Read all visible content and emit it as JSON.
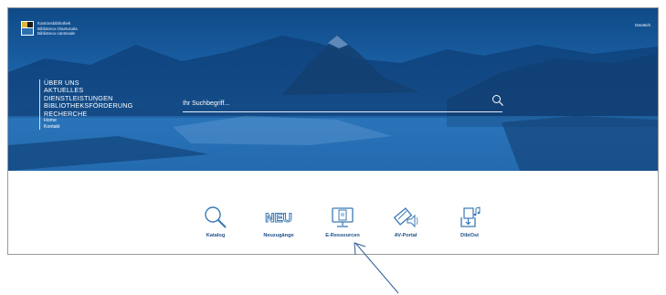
{
  "header": {
    "logo_lines": [
      "Kantonsbibliothek",
      "Biblioteca chantunala",
      "Biblioteca cantonale"
    ],
    "language": "Deutsch"
  },
  "nav": {
    "items": [
      {
        "label": "ÜBER UNS",
        "size": "big"
      },
      {
        "label": "AKTUELLES",
        "size": "big"
      },
      {
        "label": "DIENSTLEISTUNGEN",
        "size": "big"
      },
      {
        "label": "BIBLIOTHEKSFÖRDERUNG",
        "size": "big"
      },
      {
        "label": "RECHERCHE",
        "size": "big"
      },
      {
        "label": "Home",
        "size": "small"
      },
      {
        "label": "Kontakt",
        "size": "small"
      }
    ]
  },
  "search": {
    "placeholder": "Ihr Suchbegriff...",
    "icon": "search-icon"
  },
  "apps": [
    {
      "label": "Katalog",
      "icon": "magnifier-icon"
    },
    {
      "label": "Neuzugänge",
      "icon": "neu-icon",
      "icon_text": "NEU"
    },
    {
      "label": "E-Ressourcen",
      "icon": "monitor-document-icon"
    },
    {
      "label": "AV-Portal",
      "icon": "film-speaker-icon"
    },
    {
      "label": "DibiOst",
      "icon": "download-music-icon"
    }
  ],
  "colors": {
    "hero": "#1a5fa3",
    "app_icon": "#3b79b5",
    "app_label": "#1f4f86",
    "arrow": "#2d5f9a"
  }
}
